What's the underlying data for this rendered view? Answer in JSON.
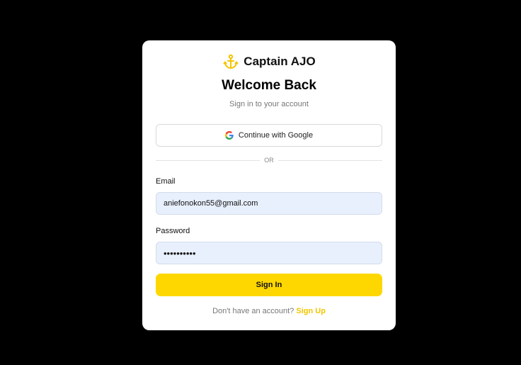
{
  "brand": {
    "name": "Captain AJO",
    "icon": "anchor-icon",
    "icon_color": "#f5c400"
  },
  "title": "Welcome Back",
  "subtitle": "Sign in to your account",
  "google_button": {
    "label": "Continue with Google",
    "icon": "google-icon"
  },
  "divider_text": "OR",
  "email": {
    "label": "Email",
    "value": "aniefonokon55@gmail.com"
  },
  "password": {
    "label": "Password",
    "value": "••••••••••"
  },
  "signin_button": {
    "label": "Sign In",
    "color": "#ffd700"
  },
  "signup": {
    "prompt": "Don't have an account?",
    "link": "Sign Up",
    "link_color": "#f2c500"
  }
}
